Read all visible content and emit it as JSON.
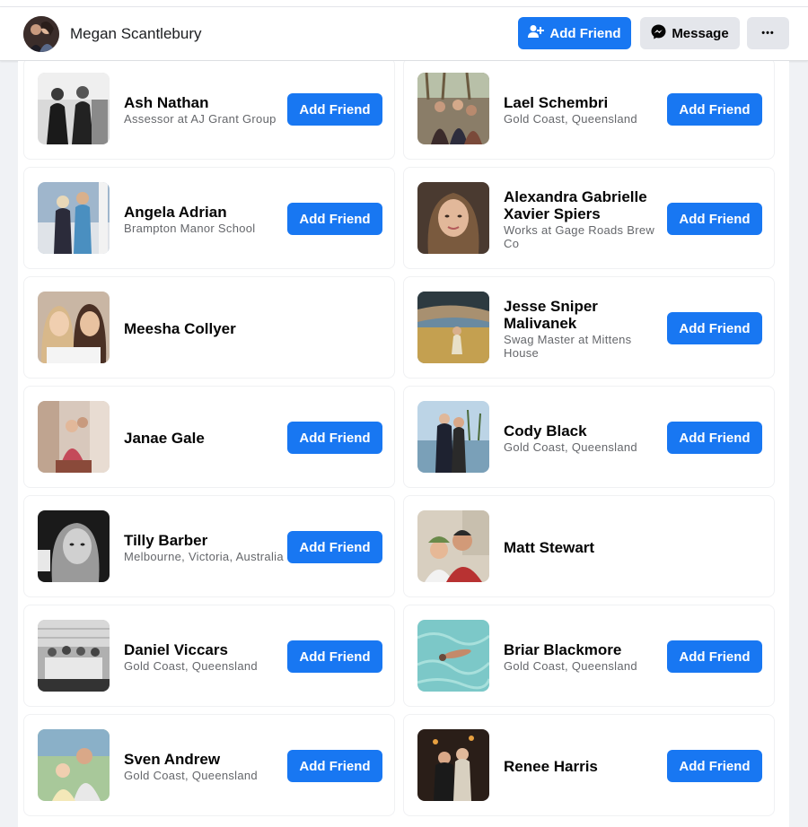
{
  "profile": {
    "name": "Megan Scantlebury",
    "add_friend_label": "Add Friend",
    "message_label": "Message",
    "more_label": "•••"
  },
  "friends": [
    {
      "name": "Ash Nathan",
      "subtitle": "Assessor at AJ Grant Group",
      "button": "Add Friend"
    },
    {
      "name": "Lael Schembri",
      "subtitle": "Gold Coast, Queensland",
      "button": "Add Friend"
    },
    {
      "name": "Angela Adrian",
      "subtitle": "Brampton Manor School",
      "button": "Add Friend"
    },
    {
      "name": "Alexandra Gabrielle Xavier Spiers",
      "subtitle": "Works at Gage Roads Brew Co",
      "button": "Add Friend"
    },
    {
      "name": "Meesha Collyer",
      "subtitle": "",
      "button": ""
    },
    {
      "name": "Jesse Sniper Malivanek",
      "subtitle": "Swag Master at Mittens House",
      "button": "Add Friend"
    },
    {
      "name": "Janae Gale",
      "subtitle": "",
      "button": "Add Friend"
    },
    {
      "name": "Cody Black",
      "subtitle": "Gold Coast, Queensland",
      "button": "Add Friend"
    },
    {
      "name": "Tilly Barber",
      "subtitle": "Melbourne, Victoria, Australia",
      "button": "Add Friend"
    },
    {
      "name": "Matt Stewart",
      "subtitle": "",
      "button": ""
    },
    {
      "name": "Daniel Viccars",
      "subtitle": "Gold Coast, Queensland",
      "button": "Add Friend"
    },
    {
      "name": "Briar Blackmore",
      "subtitle": "Gold Coast, Queensland",
      "button": "Add Friend"
    },
    {
      "name": "Sven Andrew",
      "subtitle": "Gold Coast, Queensland",
      "button": "Add Friend"
    },
    {
      "name": "Renee Harris",
      "subtitle": "",
      "button": "Add Friend"
    }
  ],
  "colors": {
    "primary": "#1877f2",
    "secondary": "#e4e6eb",
    "subtitle": "#65676b"
  },
  "icons": {
    "add_friend": "add-friend-icon",
    "message": "messenger-icon",
    "more": "more-icon"
  }
}
